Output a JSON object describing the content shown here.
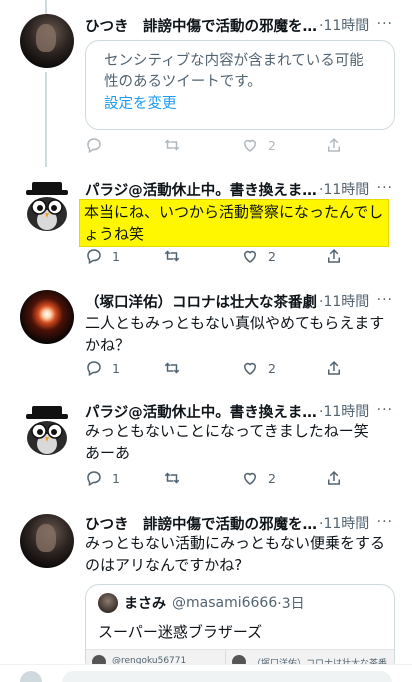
{
  "thread": [
    {
      "author": "ひつき　誹謗中傷で活動の邪魔をしないでね",
      "time": "·11時間",
      "sensitive_notice": {
        "message": "センシティブな内容が含まれている可能性のあるツイートです。",
        "link_label": "設定を変更"
      },
      "reply_count": "",
      "retweet_count": "",
      "like_count": "2"
    },
    {
      "author": "パラジ@活動休止中。書き換えました",
      "time": "·11時間",
      "text": "本当にね、いつから活動警察になったんでしょうね笑",
      "reply_count": "1",
      "retweet_count": "",
      "like_count": "2"
    },
    {
      "author": "（塚口洋佑）コロナは壮大な茶番劇",
      "time": "·11時間",
      "text": "二人ともみっともない真似やめてもらえますかね？",
      "reply_count": "1",
      "retweet_count": "",
      "like_count": "2"
    },
    {
      "author": "パラジ@活動休止中。書き換えました",
      "time": "·11時間",
      "text": "みっともないことになってきましたねー笑あーあ",
      "reply_count": "1",
      "retweet_count": "",
      "like_count": "2"
    },
    {
      "author": "ひつき　誹謗中傷で活動の邪魔をしないでね",
      "time": "·11時間",
      "text": "みっともない活動にみっともない便乗をするのはアリなんですかね?",
      "quote": {
        "name": "まさみ",
        "handle": "@masami6666",
        "time": "·3日",
        "text": "スーパー迷惑ブラザーズ",
        "thumb_left": "@rengoku56771",
        "thumb_right": "（塚口洋佑）コロナは壮大な茶番..."
      }
    }
  ],
  "more_glyph": "···",
  "colors": {
    "accent": "#1d9bf0",
    "highlight": "#fff700",
    "muted": "#536471",
    "border": "#cfd9de"
  },
  "icons": [
    "reply-icon",
    "retweet-icon",
    "like-icon",
    "share-icon",
    "more-icon"
  ]
}
